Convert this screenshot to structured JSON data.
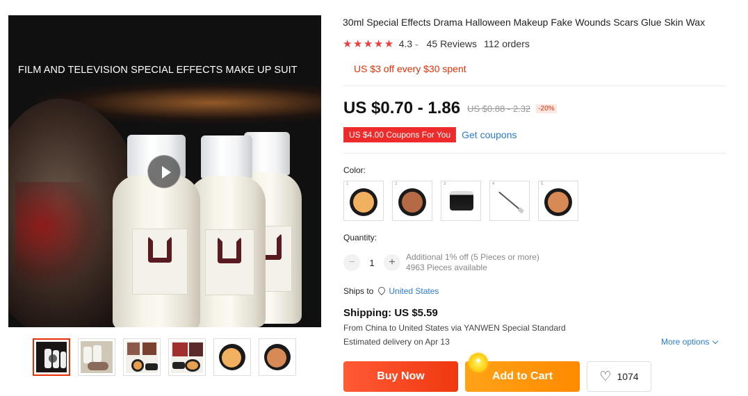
{
  "gallery": {
    "banner_text": "FILM AND TELEVISION SPECIAL EFFECTS MAKE UP SUIT",
    "thumbnails": [
      "video",
      "bottles",
      "kit-1",
      "kit-2",
      "wax-light",
      "wax-dark"
    ]
  },
  "product": {
    "title": "30ml Special Effects Drama Halloween Makeup Fake Wounds Scars Glue Skin Wax",
    "rating": "4.3",
    "reviews": "45 Reviews",
    "orders": "112 orders",
    "promo": "US $3 off every $30 spent",
    "price": "US $0.70 - 1.86",
    "original_price": "US $0.88 - 2.32",
    "discount": "-20%",
    "coupon_tag": "US $4.00 Coupons For You",
    "get_coupons": "Get coupons"
  },
  "options": {
    "color_label": "Color:",
    "colors": [
      "light-wax",
      "dark-wax",
      "black-jar",
      "spatula",
      "medium-wax"
    ],
    "quantity_label": "Quantity:",
    "quantity_value": "1",
    "minus": "−",
    "plus": "+",
    "qty_note": "Additional 1% off (5 Pieces or more)",
    "qty_available": "4963 Pieces available"
  },
  "shipping": {
    "ships_to_label": "Ships to",
    "ships_to_country": "United States",
    "cost": "Shipping: US $5.59",
    "from_text": "From China to United States via YANWEN Special Standard",
    "delivery": "Estimated delivery on Apr 13",
    "more_options": "More options"
  },
  "actions": {
    "buy_now": "Buy Now",
    "add_to_cart": "Add to Cart",
    "wishlist_count": "1074"
  },
  "colors": {
    "accent_red": "#e62e04",
    "buy_gradient": "#ff5a36",
    "cart_gradient": "#ffa318",
    "link_blue": "#2b7bd6"
  }
}
